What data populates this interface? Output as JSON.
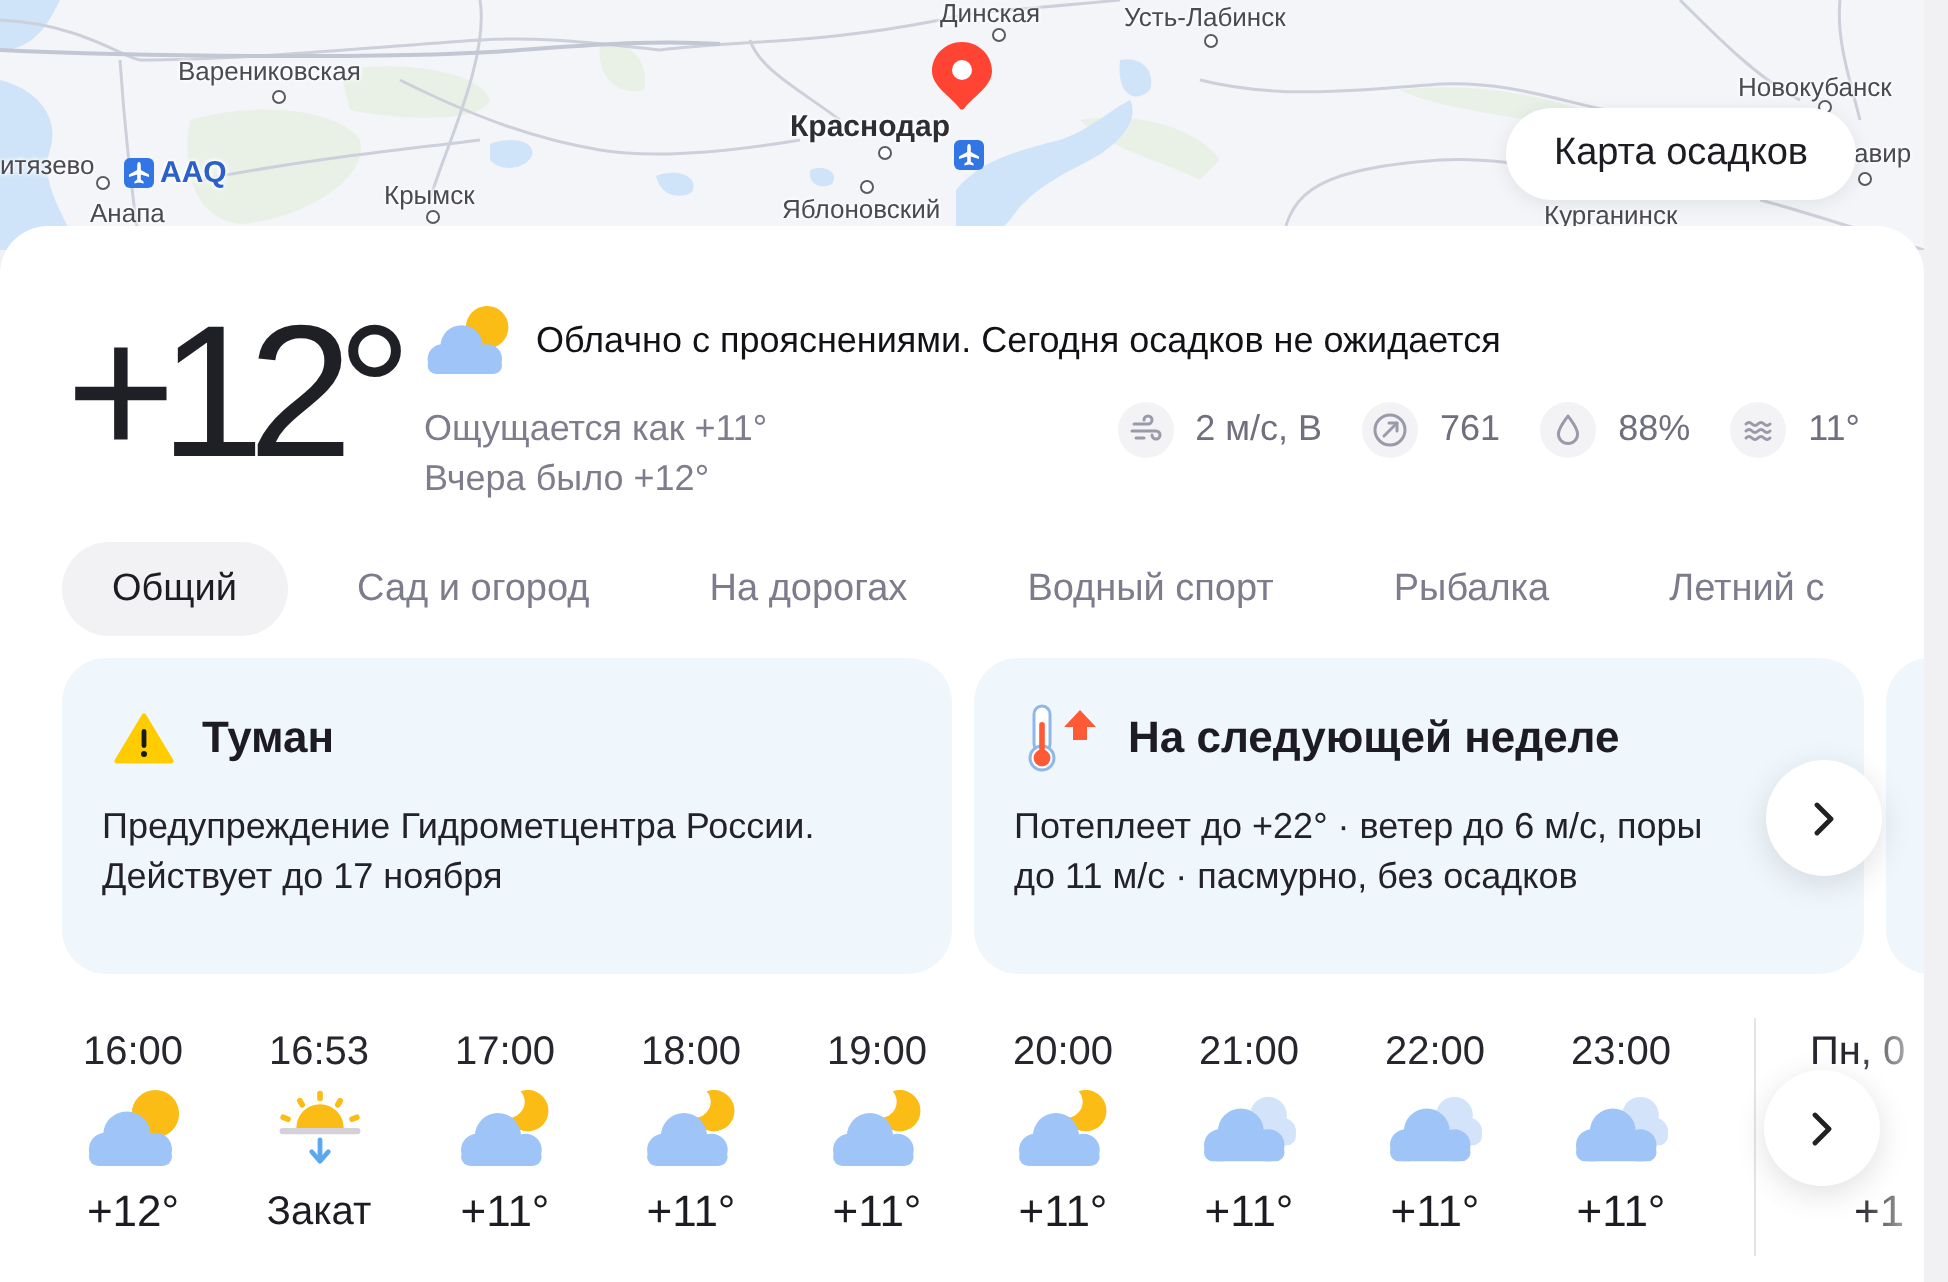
{
  "map": {
    "labels": [
      {
        "text": "Динская",
        "kind": "town"
      },
      {
        "text": "Усть-Лабинск",
        "kind": "town"
      },
      {
        "text": "Варениковская",
        "kind": "town"
      },
      {
        "text": "Новокубанск",
        "kind": "town"
      },
      {
        "text": "Краснодар",
        "kind": "city"
      },
      {
        "text": "итязево",
        "kind": "town"
      },
      {
        "text": "AAQ",
        "kind": "airport"
      },
      {
        "text": "авир",
        "kind": "town"
      },
      {
        "text": "Анапа",
        "kind": "town"
      },
      {
        "text": "Крымск",
        "kind": "town"
      },
      {
        "text": "Яблоновский",
        "kind": "town"
      },
      {
        "text": "Курганинск",
        "kind": "town"
      }
    ],
    "button": "Карта осадков"
  },
  "current": {
    "temperature": "+12°",
    "condition": "Облачно с прояснениями. Сегодня осадков не ожидается",
    "feels_like": "Ощущается как +11°",
    "yesterday": "Вчера было +12°",
    "stats": [
      {
        "kind": "wind",
        "value": "2 м/с, В"
      },
      {
        "kind": "pressure",
        "value": "761"
      },
      {
        "kind": "humidity",
        "value": "88%"
      },
      {
        "kind": "water",
        "value": "11°"
      }
    ]
  },
  "tabs": [
    {
      "label": "Общий",
      "selected": true
    },
    {
      "label": "Сад и огород",
      "selected": false
    },
    {
      "label": "На дорогах",
      "selected": false
    },
    {
      "label": "Водный спорт",
      "selected": false
    },
    {
      "label": "Рыбалка",
      "selected": false
    },
    {
      "label": "Летний с",
      "selected": false
    }
  ],
  "cards": [
    {
      "kind": "warning",
      "title": "Туман",
      "lines": [
        "Предупреждение Гидрометцентра России.",
        "Действует до 17 ноября"
      ]
    },
    {
      "kind": "forecast",
      "title": "На следующей неделе",
      "lines": [
        "Потеплеет до +22° · ветер до 6 м/с, поры",
        "до 11 м/с · пасмурно, без осадков"
      ]
    }
  ],
  "hourly": [
    {
      "time": "16:00",
      "kind": "cloud-sun",
      "value": "+12°"
    },
    {
      "time": "16:53",
      "kind": "sunset",
      "value": "Закат"
    },
    {
      "time": "17:00",
      "kind": "cloud-moon",
      "value": "+11°"
    },
    {
      "time": "18:00",
      "kind": "cloud-moon",
      "value": "+11°"
    },
    {
      "time": "19:00",
      "kind": "cloud-moon",
      "value": "+11°"
    },
    {
      "time": "20:00",
      "kind": "cloud-moon",
      "value": "+11°"
    },
    {
      "time": "21:00",
      "kind": "cloudy",
      "value": "+11°"
    },
    {
      "time": "22:00",
      "kind": "cloudy",
      "value": "+11°"
    },
    {
      "time": "23:00",
      "kind": "cloudy",
      "value": "+11°"
    }
  ],
  "next_day": {
    "time": "Пн, 0",
    "value": "+1"
  }
}
